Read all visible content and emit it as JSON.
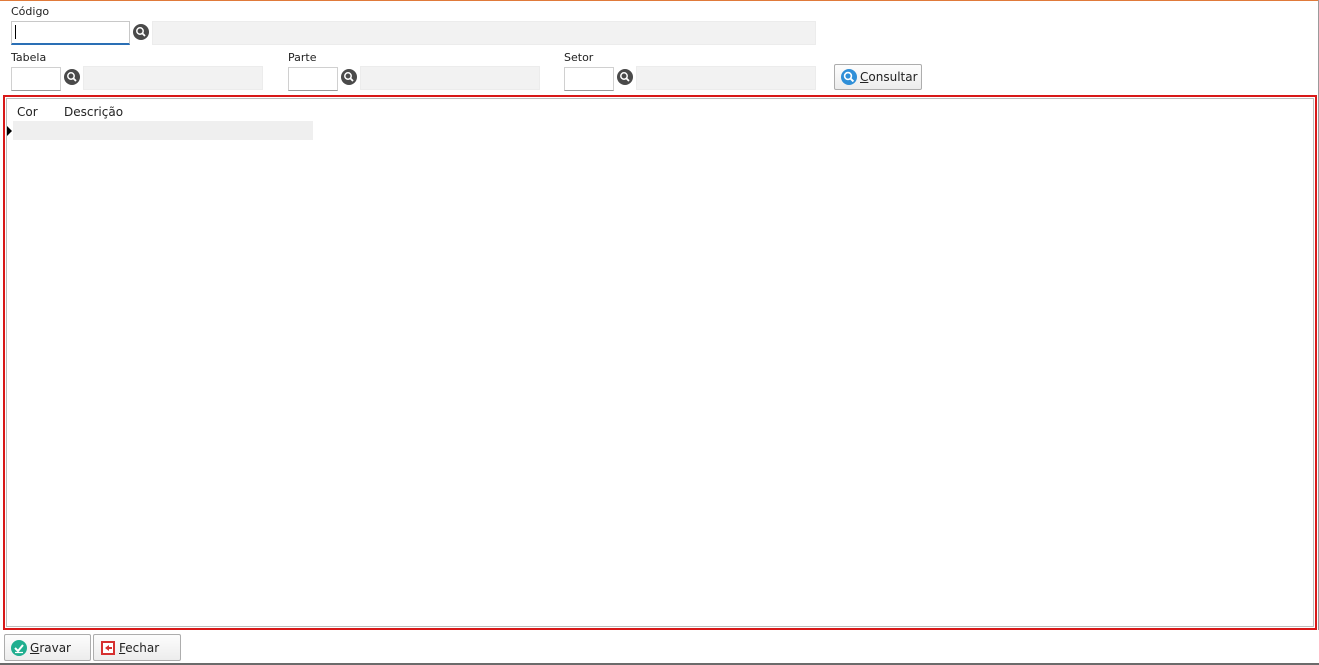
{
  "form": {
    "codigo": {
      "label": "Código",
      "value": ""
    },
    "tabela": {
      "label": "Tabela",
      "value": ""
    },
    "parte": {
      "label": "Parte",
      "value": ""
    },
    "setor": {
      "label": "Setor",
      "value": ""
    },
    "consultar_button": {
      "hotkey": "C",
      "rest": "onsultar",
      "icon": "search-icon"
    }
  },
  "grid": {
    "columns": [
      "Cor",
      "Descrição"
    ],
    "rows": [
      {
        "cor": "",
        "descricao": ""
      }
    ],
    "highlight_color": "#d81818"
  },
  "footer": {
    "gravar_button": {
      "hotkey": "G",
      "rest": "ravar",
      "icon": "check-icon"
    },
    "fechar_button": {
      "hotkey": "F",
      "rest": "echar",
      "icon": "exit-icon"
    }
  },
  "colors": {
    "accent_top": "#e07a3a",
    "focus": "#2a6fb5",
    "gravar_icon": "#1fae8f",
    "fechar_icon": "#d63030"
  }
}
